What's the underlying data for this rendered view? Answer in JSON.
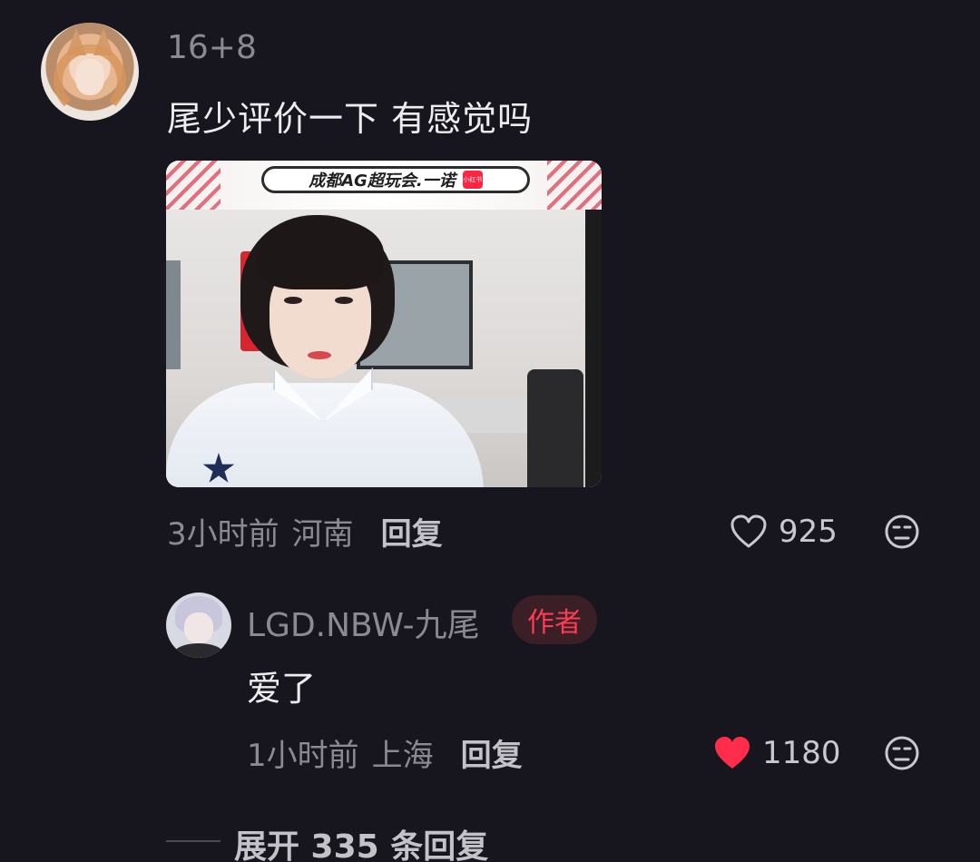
{
  "comment": {
    "username": "16+8",
    "text": "尾少评价一下 有感觉吗",
    "image": {
      "banner_text": "成都AG超玩会.一诺",
      "banner_logo": "小红书"
    },
    "time": "3小时前",
    "location": "河南",
    "reply_label": "回复",
    "like_count": "925",
    "liked": false
  },
  "reply": {
    "username": "LGD.NBW-九尾",
    "badge": "作者",
    "text": "爱了",
    "time": "1小时前",
    "location": "上海",
    "reply_label": "回复",
    "like_count": "1180",
    "liked": true
  },
  "expand": {
    "label": "展开 335 条回复"
  },
  "colors": {
    "background": "#17161e",
    "like_active": "#ff2d4b",
    "badge_text": "#ff3b53"
  },
  "icons": [
    "heart-outline-icon",
    "heart-filled-icon",
    "dislike-face-icon"
  ]
}
